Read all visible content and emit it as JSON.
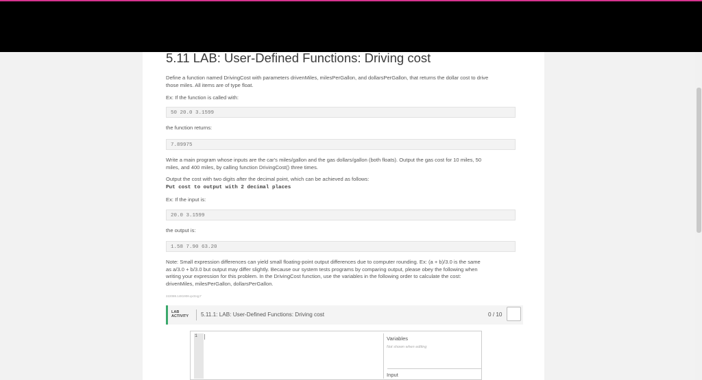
{
  "title": "5.11 LAB: User-Defined Functions: Driving cost",
  "body": {
    "p1_line1": "Define a function named DrivingCost with parameters drivenMiles, milesPerGallon, and dollarsPerGallon, that returns the dollar cost to drive",
    "p1_line2": "those miles. All items are of type float.",
    "ex1_label": "Ex: If the function is called with:",
    "ex1_code": "50 20.0 3.1599",
    "returns_label": "the function returns:",
    "returns_code": "7.89975",
    "p2_line1": "Write a main program whose inputs are the car's miles/gallon and the gas dollars/gallon (both floats). Output the gas cost for 10 miles, 50",
    "p2_line2": "miles, and 400 miles, by calling function DrivingCost() three times.",
    "p3": "Output the cost with two digits after the decimal point, which can be achieved as follows:",
    "p3_code": "Put cost to output with 2 decimal places",
    "ex2_label": "Ex: If the input is:",
    "ex2_code": "20.0 3.1599",
    "output_label": "the output is:",
    "output_code": "1.58 7.90 63.20",
    "note_line1": "Note: Small expression differences can yield small floating-point output differences due to computer rounding. Ex: (a + b)/3.0 is the same",
    "note_line2": "as a/3.0 + b/3.0 but output may differ slightly. Because our system tests programs by comparing output, please obey the following when",
    "note_line3": "writing your expression for this problem. In the DrivingCost function, use the variables in the following order to calculate the cost:",
    "note_line4": "drivenMiles, milesPerGallon, dollarsPerGallon.",
    "tiny_id": "222088.1481908.qx3zqy7"
  },
  "lab": {
    "tag_line1": "LAB",
    "tag_line2": "ACTIVITY",
    "title": "5.11.1: LAB: User-Defined Functions: Driving cost",
    "score": "0 / 10"
  },
  "editor": {
    "line_number": "1",
    "variables_label": "Variables",
    "variables_sub": "Not shown when editing",
    "input_label": "Input"
  },
  "colors": {
    "accent_green": "#3aa86b",
    "top_line": "#d6338f"
  }
}
